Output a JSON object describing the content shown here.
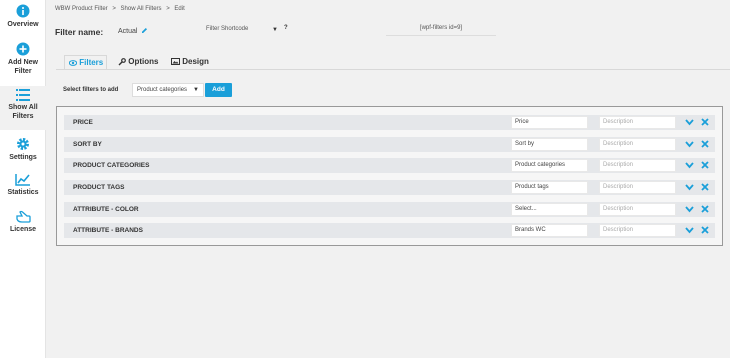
{
  "sidebar": {
    "items": [
      {
        "label": "Overview",
        "icon": "info-icon"
      },
      {
        "label": "Add New Filter",
        "icon": "plus-circle-icon"
      },
      {
        "label": "Show All Filters",
        "icon": "list-icon"
      },
      {
        "label": "Settings",
        "icon": "gear-icon"
      },
      {
        "label": "Statistics",
        "icon": "chart-icon"
      },
      {
        "label": "License",
        "icon": "hand-pointer-icon"
      }
    ]
  },
  "breadcrumb": [
    "WBW Product Filter",
    ">",
    "Show All Filters",
    ">",
    "Edit"
  ],
  "filter_name": {
    "label": "Filter name:",
    "value": "Actual"
  },
  "shortcode": {
    "select_label": "Filter Shortcode",
    "help": "?",
    "value": "[wpf-filters id=9]"
  },
  "tabs": [
    {
      "label": "Filters",
      "icon": "eye-icon"
    },
    {
      "label": "Options",
      "icon": "wrench-icon"
    },
    {
      "label": "Design",
      "icon": "image-icon"
    }
  ],
  "add_filter": {
    "label": "Select filters to add",
    "selected": "Product categories",
    "button": "Add"
  },
  "filters": [
    {
      "title": "PRICE",
      "name": "Price",
      "description": "Description"
    },
    {
      "title": "SORT BY",
      "name": "Sort by",
      "description": "Description"
    },
    {
      "title": "PRODUCT CATEGORIES",
      "name": "Product categories",
      "description": "Description"
    },
    {
      "title": "PRODUCT TAGS",
      "name": "Product tags",
      "description": "Description"
    },
    {
      "title": "ATTRIBUTE - COLOR",
      "name": "Select...",
      "description": "Description"
    },
    {
      "title": "ATTRIBUTE - BRANDS",
      "name": "Brands WC",
      "description": "Description"
    }
  ],
  "colors": {
    "accent": "#1a9fd9",
    "row_bg": "#e5e7ea"
  }
}
